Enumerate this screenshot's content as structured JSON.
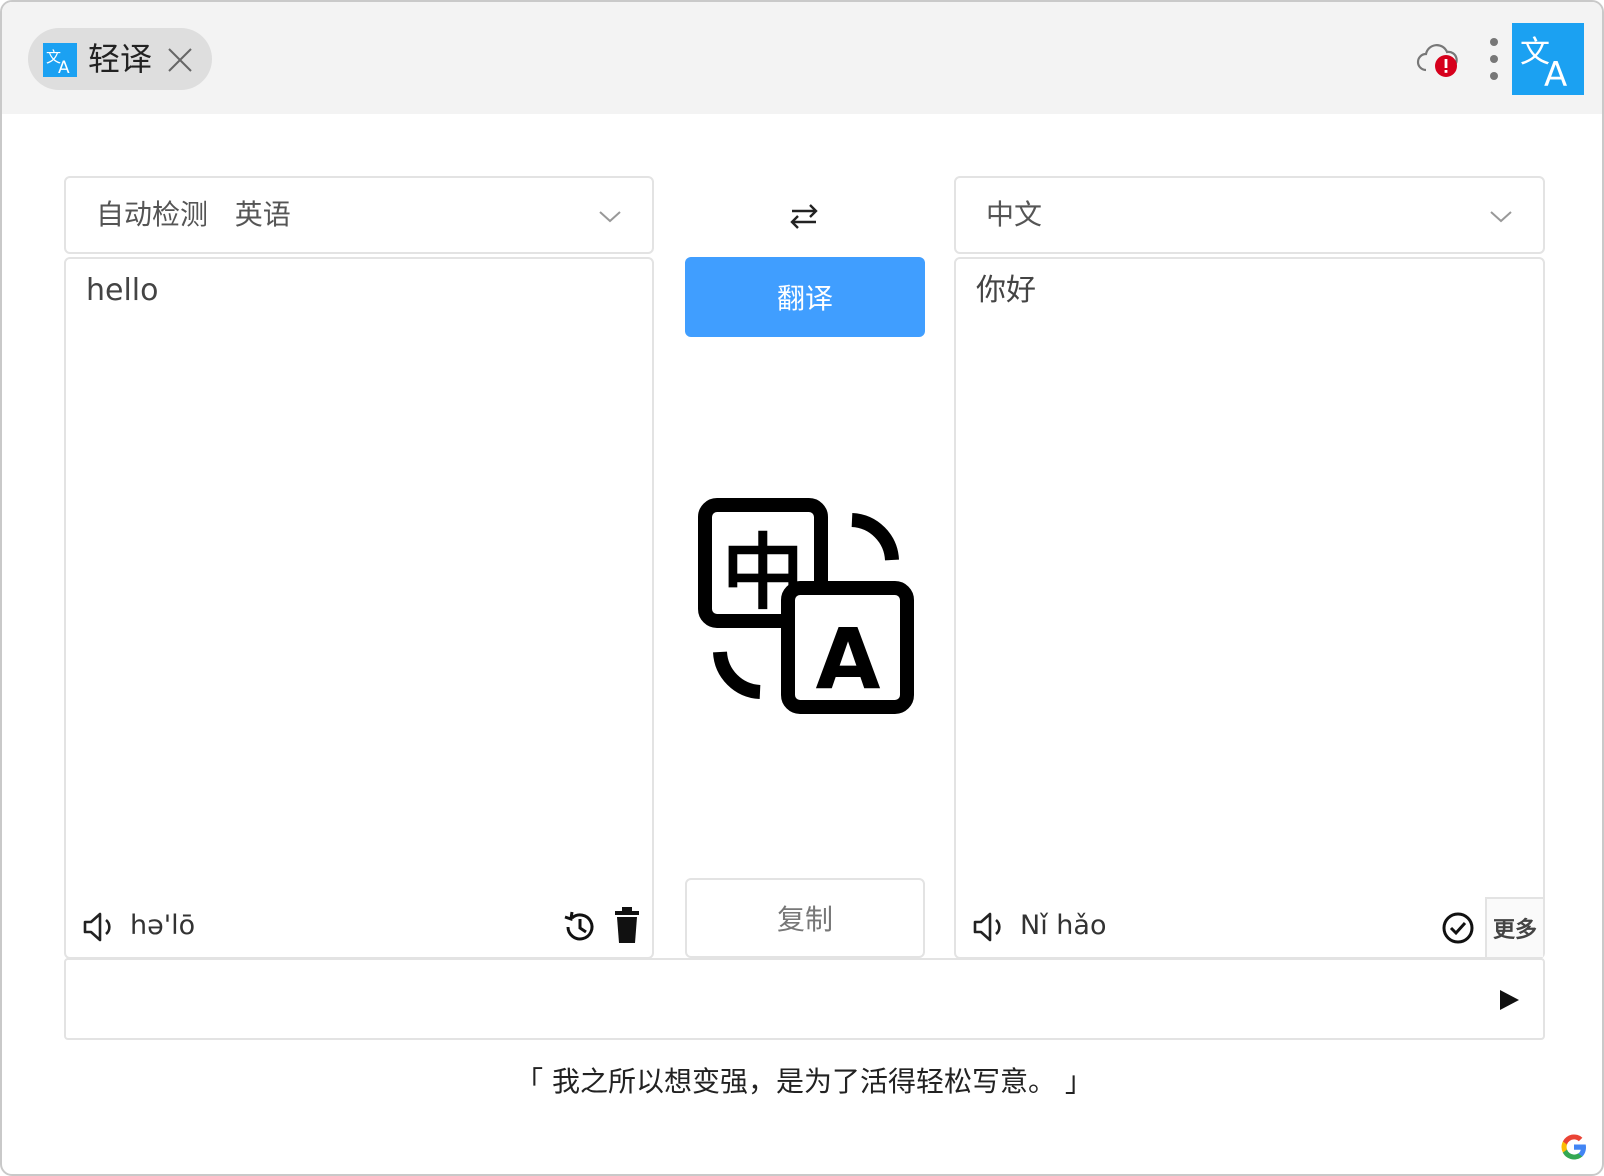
{
  "tab": {
    "title": "轻译"
  },
  "source": {
    "language_label": "自动检测   英语",
    "text": "hello",
    "phonetic": "hə'lō"
  },
  "target": {
    "language_label": "中文",
    "text": "你好",
    "phonetic": "Nǐ hǎo",
    "more_label": "更多"
  },
  "actions": {
    "translate_label": "翻译",
    "copy_label": "复制"
  },
  "input_bar": {
    "value": ""
  },
  "quote": "「 我之所以想变强，是为了活得轻松写意。 」",
  "colors": {
    "accent": "#409eff",
    "logo": "#1ba1f2",
    "alert": "#d6001c"
  }
}
